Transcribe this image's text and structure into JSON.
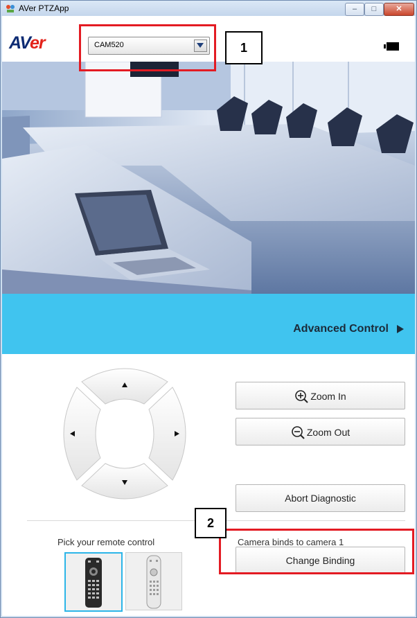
{
  "window": {
    "title": "AVer PTZApp",
    "min_glyph": "–",
    "max_glyph": "□",
    "close_glyph": "✕"
  },
  "header": {
    "logo_prefix": "AV",
    "logo_suffix": "er",
    "camera_select": {
      "value": "CAM520"
    }
  },
  "callouts": {
    "one": "1",
    "two": "2"
  },
  "advanced": {
    "label": "Advanced Control"
  },
  "controls": {
    "zoom_in_label": "Zoom In",
    "zoom_out_label": "Zoom Out",
    "abort_label": "Abort Diagnostic",
    "change_binding_label": "Change Binding"
  },
  "remote": {
    "pick_label": "Pick your remote control",
    "bind_status": "Camera binds to camera 1"
  },
  "colors": {
    "accent_bar": "#40c4ef",
    "highlight": "#e31b23",
    "brand_blue": "#0d2b73"
  }
}
